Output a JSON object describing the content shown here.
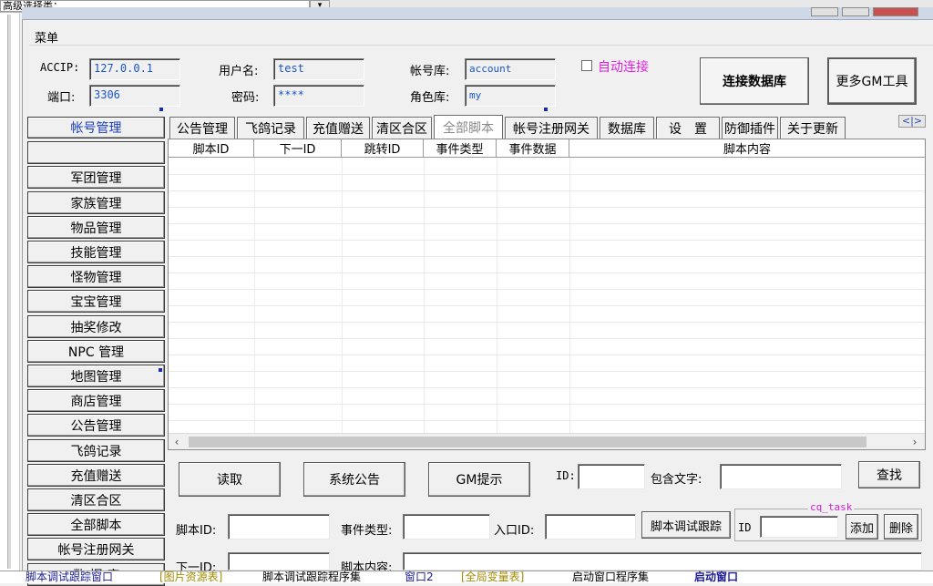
{
  "top_combo": {
    "value": "高级选择类："
  },
  "menu": {
    "label": "菜单"
  },
  "connection": {
    "accip_label": "ACCIP:",
    "accip_value": "127.0.0.1",
    "port_label": "端口:",
    "port_value": "3306",
    "user_label": "用户名:",
    "user_value": "test",
    "password_label": "密码:",
    "password_value": "****",
    "account_db_label": "帐号库:",
    "account_db_value": "account",
    "role_db_label": "角色库:",
    "role_db_value": "my",
    "auto_connect_label": "自动连接",
    "auto_connect_checked": false,
    "connect_button": "连接数据库",
    "more_tools_button": "更多GM工具"
  },
  "nav": {
    "items": [
      "帐号管理",
      "",
      "军团管理",
      "家族管理",
      "物品管理",
      "技能管理",
      "怪物管理",
      "宝宝管理",
      "抽奖修改",
      "NPC 管理",
      "地图管理",
      "商店管理",
      "公告管理",
      "飞鸽记录",
      "充值赠送",
      "清区合区",
      "全部脚本",
      "帐号注册网关",
      "数 据 库"
    ]
  },
  "tabs": [
    "公告管理",
    "飞鸽记录",
    "充值赠送",
    "清区合区",
    "全部脚本",
    "帐号注册网关",
    "数据库",
    "设　置",
    "防御插件",
    "关于更新"
  ],
  "selected_tab": "全部脚本",
  "tab_scroll": "<|>",
  "grid": {
    "columns": [
      "脚本ID",
      "下一ID",
      "跳转ID",
      "事件类型",
      "事件数据",
      "脚本内容"
    ],
    "rows": []
  },
  "actions": {
    "read_button": "读取",
    "announce_button": "系统公告",
    "gm_tip_button": "GM提示",
    "id_label": "ID:",
    "contains_label": "包含文字:",
    "search_button": "查找"
  },
  "editor": {
    "script_id_label": "脚本ID:",
    "event_type_label": "事件类型:",
    "entry_id_label": "入口ID:",
    "debug_trace_button": "脚本调试跟踪",
    "next_id_label": "下一ID:",
    "script_content_label": "脚本内容:"
  },
  "cq_task": {
    "caption": "cq_task",
    "id_label": "ID",
    "add_button": "添加",
    "delete_button": "删除"
  },
  "bottom_tabs": [
    {
      "label": "脚本调试跟踪窗口",
      "color": "#1a1a9a"
    },
    {
      "label": "[图片资源表]",
      "color": "#a08a00"
    },
    {
      "label": "脚本调试跟踪程序集",
      "color": "#000000"
    },
    {
      "label": "窗口2",
      "color": "#1a1a9a"
    },
    {
      "label": "[全局变量表]",
      "color": "#a08a00"
    },
    {
      "label": "启动窗口程序集",
      "color": "#000000"
    },
    {
      "label": "启动窗口",
      "color": "#1a1a9a"
    }
  ]
}
